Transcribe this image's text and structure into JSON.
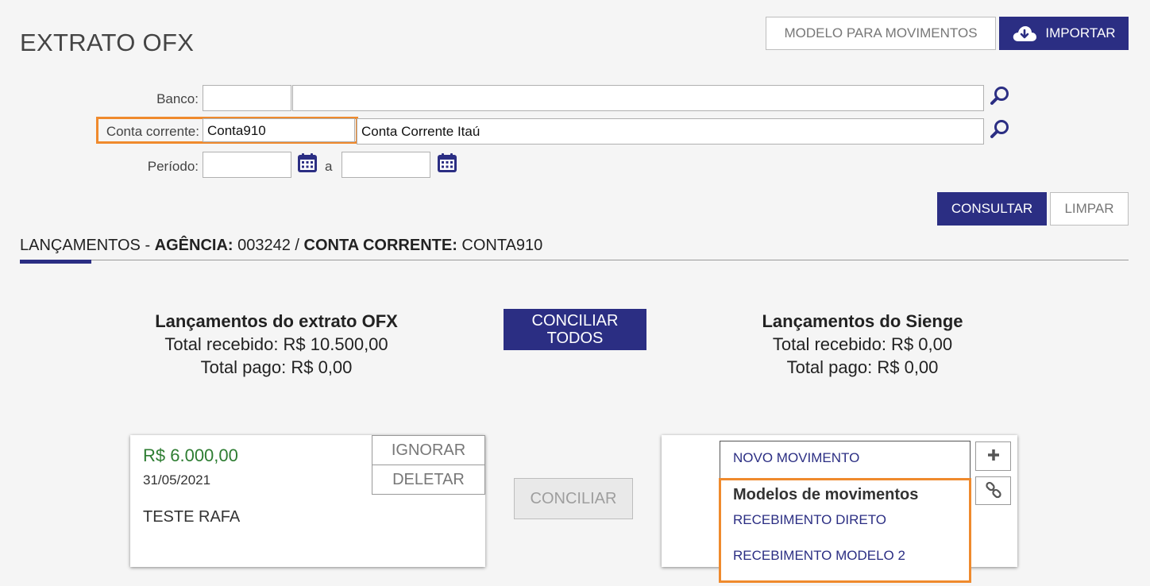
{
  "header": {
    "title": "EXTRATO OFX",
    "model_button": "MODELO PARA MOVIMENTOS",
    "import_button": "IMPORTAR"
  },
  "form": {
    "banco": {
      "label": "Banco:",
      "code": "",
      "name": ""
    },
    "conta": {
      "label": "Conta corrente:",
      "code": "Conta910",
      "name": "Conta Corrente Itaú"
    },
    "periodo": {
      "label": "Período:",
      "from": "",
      "separator": "a",
      "to": ""
    },
    "consultar": "CONSULTAR",
    "limpar": "LIMPAR"
  },
  "section": {
    "title": "LANÇAMENTOS",
    "dash": " - ",
    "agencia_label": "AGÊNCIA:",
    "agencia_value": " 003242 / ",
    "conta_label": "CONTA CORRENTE:",
    "conta_value": " CONTA910"
  },
  "ofx_summary": {
    "title": "Lançamentos do extrato OFX",
    "recebido": "Total recebido: R$ 10.500,00",
    "pago": "Total pago: R$ 0,00"
  },
  "conciliar_todos": "CONCILIAR TODOS",
  "sienge_summary": {
    "title": "Lançamentos do Sienge",
    "recebido": "Total recebido: R$ 0,00",
    "pago": "Total pago: R$ 0,00"
  },
  "ofx_item": {
    "amount": "R$ 6.000,00",
    "date": "31/05/2021",
    "description": "TESTE RAFA",
    "ignorar": "IGNORAR",
    "deletar": "DELETAR"
  },
  "conciliar": "CONCILIAR",
  "dropdown": {
    "novo_movimento": "NOVO MOVIMENTO",
    "models_header": "Modelos de movimentos",
    "models": [
      "RECEBIMENTO DIRETO",
      "RECEBIMENTO MODELO 2"
    ]
  },
  "colors": {
    "primary": "#2b2e83",
    "highlight": "#ef8a2d",
    "amount_green": "#2e7d32"
  }
}
